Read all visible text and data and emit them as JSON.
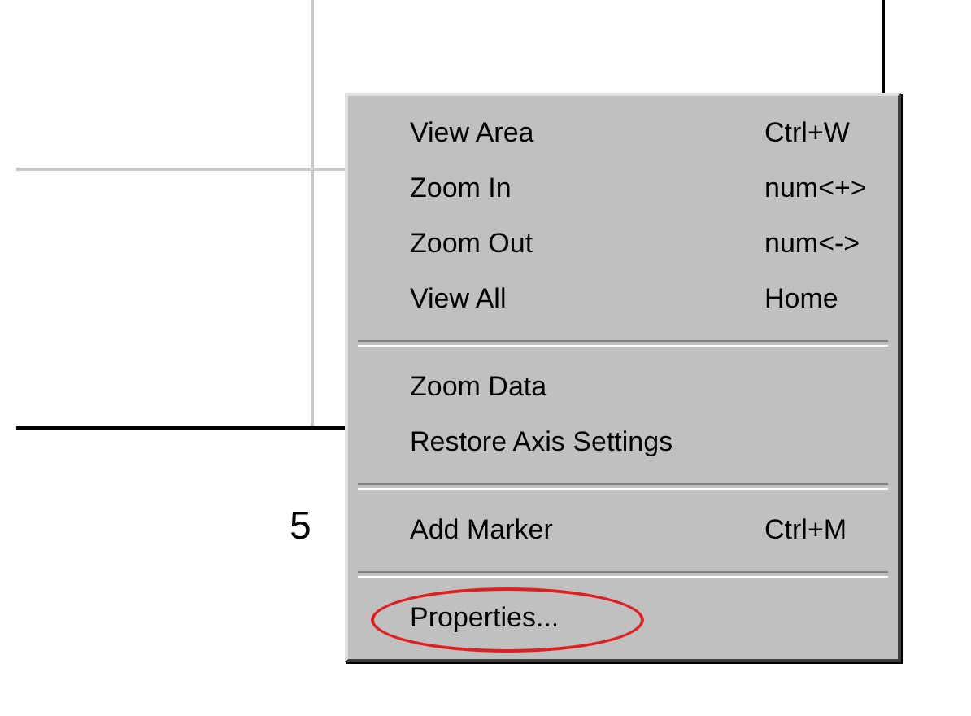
{
  "axis": {
    "tick_label": "5"
  },
  "menu": {
    "sections": [
      [
        {
          "label": "View Area",
          "shortcut": "Ctrl+W",
          "circled": false
        },
        {
          "label": "Zoom In",
          "shortcut": "num<+>",
          "circled": false
        },
        {
          "label": "Zoom Out",
          "shortcut": "num<->",
          "circled": false
        },
        {
          "label": "View All",
          "shortcut": "Home",
          "circled": false
        }
      ],
      [
        {
          "label": "Zoom Data",
          "circled": false
        },
        {
          "label": "Restore Axis Settings",
          "circled": false
        }
      ],
      [
        {
          "label": "Add Marker",
          "shortcut": "Ctrl+M",
          "circled": false
        }
      ],
      [
        {
          "label": "Properties...",
          "circled": true
        }
      ]
    ]
  }
}
